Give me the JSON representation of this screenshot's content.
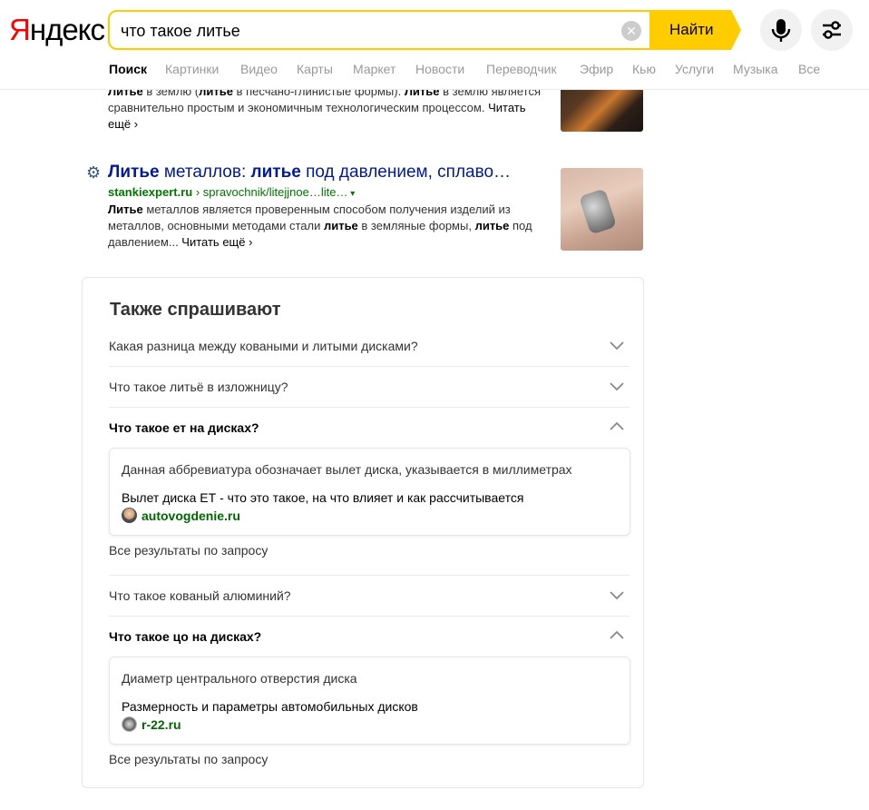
{
  "header": {
    "logo_first": "Я",
    "logo_rest": "ндекс",
    "search_value": "что такое литье",
    "find_label": "Найти",
    "clear_symbol": "✕"
  },
  "nav": {
    "items": [
      "Поиск",
      "Картинки",
      "Видео",
      "Карты",
      "Маркет",
      "Новости",
      "Переводчик",
      "Эфир",
      "Кью",
      "Услуги",
      "Музыка",
      "Все"
    ],
    "active": "Поиск"
  },
  "results": {
    "partial": {
      "snippet_parts": [
        {
          "b": "Литье"
        },
        {
          "t": " в землю ("
        },
        {
          "b": "литье"
        },
        {
          "t": " в песчано-глинистые формы). "
        },
        {
          "b": "Литье"
        },
        {
          "t": " в землю является сравнительно простым и экономичным технологическим процессом. "
        }
      ],
      "read_more": "Читать ещё ›"
    },
    "second": {
      "title_parts": [
        {
          "b": "Литье"
        },
        {
          "t": " металлов: "
        },
        {
          "b": "литье"
        },
        {
          "t": " под давлением, сплаво…"
        }
      ],
      "host": "stankiexpert.ru",
      "path": " › spravochnik/litejjnoe…lite…",
      "path_arrow": " ▾",
      "snippet_parts": [
        {
          "b": "Литье"
        },
        {
          "t": " металлов является проверенным способом получения изделий из металлов, основными методами стали "
        },
        {
          "b": "литье"
        },
        {
          "t": " в земляные формы, "
        },
        {
          "b": "литье"
        },
        {
          "t": " под давлением... "
        }
      ],
      "read_more": "Читать ещё ›",
      "favicon": "gear-icon"
    }
  },
  "also_asked": {
    "title": "Также спрашивают",
    "questions": [
      {
        "text": "Какая разница между коваными и литыми дисками?",
        "open": false
      },
      {
        "text": "Что такое литьё в изложницу?",
        "open": false
      },
      {
        "text": "Что такое ет на дисках?",
        "open": true,
        "answer": "Данная аббревиатура обозначает вылет диска, указывается в миллиметрах",
        "link": "Вылет диска ЕТ - что это такое, на что влияет и как рассчитывается",
        "site": "autovogdenie.ru"
      },
      {
        "text": "Что такое кованый алюминий?",
        "open": false
      },
      {
        "text": "Что такое цо на дисках?",
        "open": true,
        "answer": "Диаметр центрального отверстия диска",
        "link": "Размерность и параметры автомобильных дисков",
        "site": "r-22.ru"
      }
    ],
    "all_results_label": "Все результаты по запросу"
  },
  "colors": {
    "accent_yellow": "#ffcc00",
    "logo_red": "#ff0000",
    "link_blue": "#001a99",
    "url_green": "#007700"
  }
}
